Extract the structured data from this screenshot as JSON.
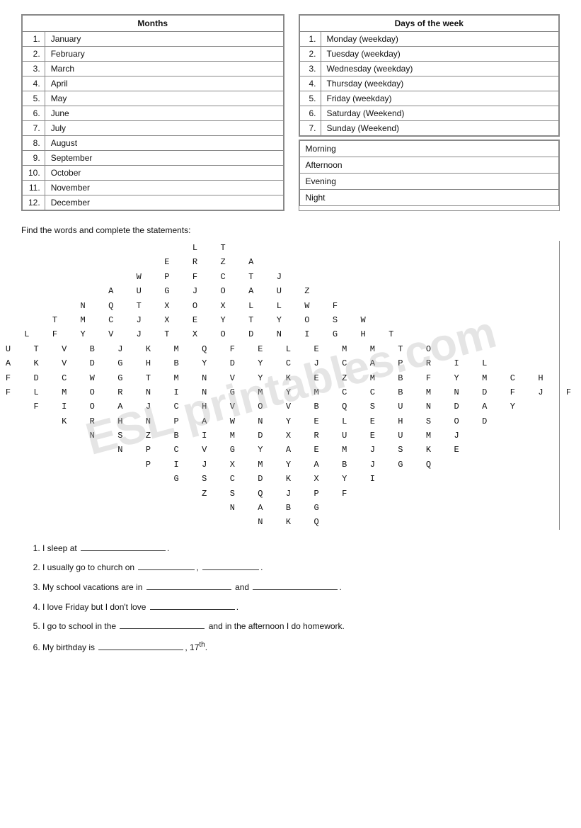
{
  "months_table": {
    "header": "Months",
    "items": [
      {
        "num": "1.",
        "name": "January"
      },
      {
        "num": "2.",
        "name": "February"
      },
      {
        "num": "3.",
        "name": "March"
      },
      {
        "num": "4.",
        "name": "April"
      },
      {
        "num": "5.",
        "name": "May"
      },
      {
        "num": "6.",
        "name": "June"
      },
      {
        "num": "7.",
        "name": "July"
      },
      {
        "num": "8.",
        "name": "August"
      },
      {
        "num": "9.",
        "name": "September"
      },
      {
        "num": "10.",
        "name": "October"
      },
      {
        "num": "11.",
        "name": "November"
      },
      {
        "num": "12.",
        "name": "December"
      }
    ]
  },
  "days_table": {
    "header": "Days of the week",
    "items": [
      {
        "num": "1.",
        "name": "Monday (weekday)"
      },
      {
        "num": "2.",
        "name": "Tuesday (weekday)"
      },
      {
        "num": "3.",
        "name": "Wednesday (weekday)"
      },
      {
        "num": "4.",
        "name": "Thursday (weekday)"
      },
      {
        "num": "5.",
        "name": "Friday (weekday)"
      },
      {
        "num": "6.",
        "name": "Saturday (Weekend)"
      },
      {
        "num": "7.",
        "name": "Sunday (Weekend)"
      }
    ]
  },
  "time_of_day": {
    "items": [
      "Morning",
      "Afternoon",
      "Evening",
      "Night"
    ]
  },
  "wordsearch": {
    "instruction": "Find the words and complete the statements:",
    "grid": [
      "                    L  T",
      "                 E  R  Z  A",
      "              W  P  F  C  T  J",
      "           A  U  G  J  O  A  U  Z",
      "        N  Q  T  X  O  X  L  L  W  F",
      "     T  M  C  J  X  E  Y  T  Y  O  S  W",
      "  L  F  Y  V  J  T  X  O  D  N  I  G  H  T",
      "U  T  V  B  J  K  M  Q  F  E  L  E  M  M  T  O",
      "A  K  V  D  G  H  B  Y  D  Y  C  J  C  A  P  R  I  L",
      "F  D  C  W  G  T  M  N  V  Y  K  E  Z  M  B  F  Y  M  C  H",
      "F  L  M  O  R  N  I  N  G  M  Y  M  C  C  B  M  N  D  F  J  F",
      "   F  I  O  A  J  C  H  V  O  V  B  Q  S  U  N  D  A  Y",
      "      K  R  H  N  P  A  W  N  Y  E  L  E  H  S  O  D",
      "         N  S  Z  B  I  M  D  X  R  U  E  U  M  J",
      "            N  P  C  V  G  Y  A  E  M  J  S  K  E",
      "               P  I  J  X  M  Y  A  B  J  G  Q",
      "                  G  S  C  D  K  X  Y  I",
      "                     Z  S  Q  J  P  F",
      "                        N  A  B  G",
      "                           N  K  Q"
    ]
  },
  "statements": {
    "label": "Find the words and complete the statements:",
    "items": [
      "I sleep at _____________.",
      "I usually go to church on _________, ________.",
      "My school vacations are in _____________ and ____________.",
      "I love Friday but I don't love _____________.",
      "I go to school in the _____________ and in the afternoon I do homework.",
      "My birthday is _____________, 17th."
    ]
  }
}
